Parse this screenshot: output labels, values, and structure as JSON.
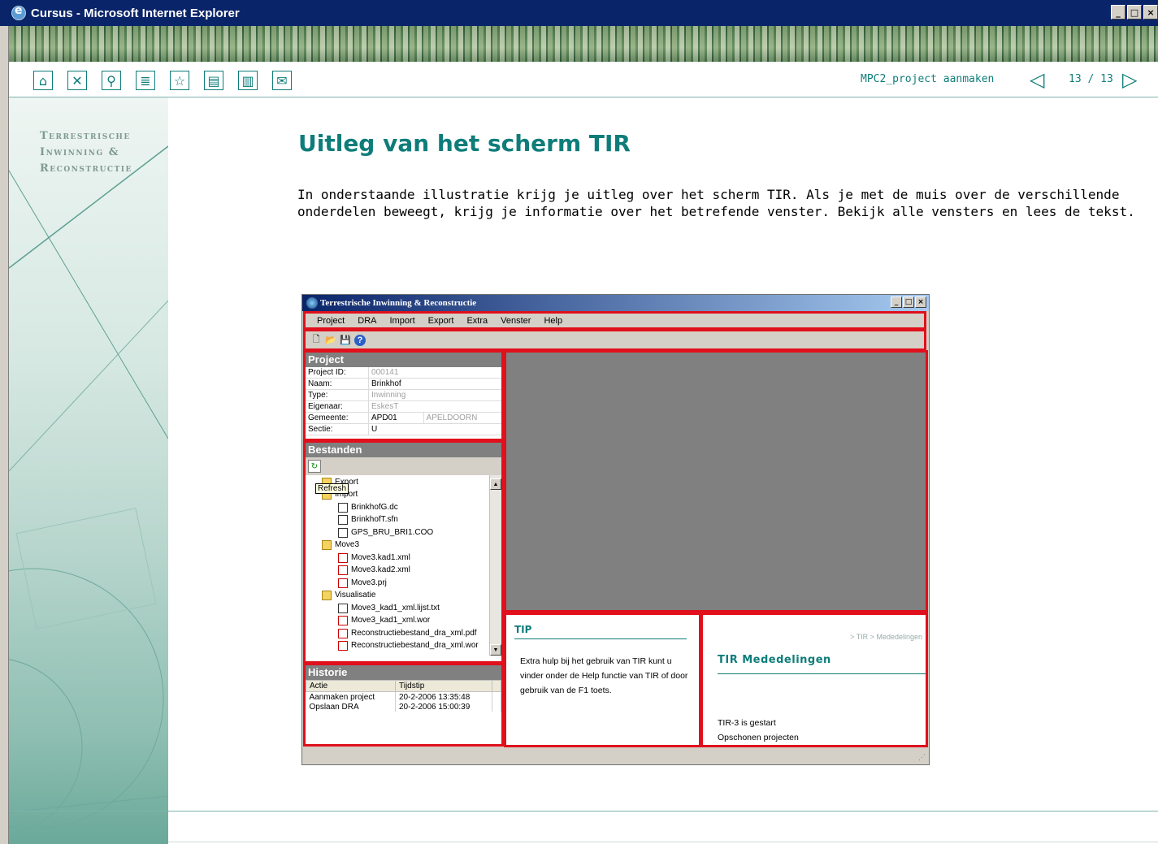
{
  "window": {
    "title": "Cursus - Microsoft Internet Explorer",
    "controls": [
      "_",
      "□",
      "×"
    ]
  },
  "navbar": {
    "icons": [
      "home-icon",
      "close-icon",
      "search-icon",
      "contents-icon",
      "favorite-icon",
      "page-icon",
      "book-icon",
      "mail-icon"
    ],
    "glyphs": [
      "⌂",
      "✕",
      "⚲",
      "≣",
      "☆",
      "▤",
      "▥",
      "✉"
    ],
    "breadcrumb": "MPC2_project aanmaken",
    "prev": "◁",
    "page": "13 / 13",
    "next": "▷"
  },
  "sidebar": {
    "brand_lines": [
      "Terrestrische",
      "Inwinning &",
      "Reconstructie"
    ]
  },
  "main": {
    "title": "Uitleg van het scherm TIR",
    "intro": "In onderstaande illustratie krijg je uitleg over het scherm TIR. Als je met de muis over de verschillende\nonderdelen beweegt, krijg je informatie over het betrefende venster. Bekijk alle vensters en lees de tekst."
  },
  "app": {
    "title": "Terrestrische Inwinning & Reconstructie",
    "controls": [
      "_",
      "□",
      "×"
    ],
    "menu": [
      "Project",
      "DRA",
      "Import",
      "Export",
      "Extra",
      "Venster",
      "Help"
    ],
    "toolbar": [
      "new-icon",
      "open-icon",
      "save-icon",
      "help-icon"
    ],
    "toolbar_glyphs": [
      "🗋",
      "📂",
      "💾",
      "?"
    ],
    "project": {
      "heading": "Project",
      "rows": [
        {
          "label": "Project ID:",
          "value": "000141",
          "extra": ""
        },
        {
          "label": "Naam:",
          "value": "Brinkhof",
          "extra": ""
        },
        {
          "label": "Type:",
          "value": "Inwinning",
          "extra": ""
        },
        {
          "label": "Eigenaar:",
          "value": "EskesT",
          "extra": ""
        },
        {
          "label": "Gemeente:",
          "value": "APD01",
          "extra": "APELDOORN"
        },
        {
          "label": "Sectie:",
          "value": "U",
          "extra": ""
        }
      ]
    },
    "bestanden": {
      "heading": "Bestanden",
      "refresh_icon": "↻",
      "tooltip": "Refresh",
      "items": [
        {
          "text": "Export",
          "kind": "folder",
          "indent": 1
        },
        {
          "text": "Import",
          "kind": "folder",
          "indent": 1
        },
        {
          "text": "BrinkhofG.dc",
          "kind": "file",
          "indent": 2
        },
        {
          "text": "BrinkhofT.sfn",
          "kind": "file",
          "indent": 2
        },
        {
          "text": "GPS_BRU_BRI1.COO",
          "kind": "file",
          "indent": 2
        },
        {
          "text": "Move3",
          "kind": "folder",
          "indent": 1
        },
        {
          "text": "Move3.kad1.xml",
          "kind": "file-red",
          "indent": 2
        },
        {
          "text": "Move3.kad2.xml",
          "kind": "file-red",
          "indent": 2
        },
        {
          "text": "Move3.prj",
          "kind": "file-red",
          "indent": 2
        },
        {
          "text": "Visualisatie",
          "kind": "folder",
          "indent": 1
        },
        {
          "text": "Move3_kad1_xml.lijst.txt",
          "kind": "file",
          "indent": 2
        },
        {
          "text": "Move3_kad1_xml.wor",
          "kind": "file-red",
          "indent": 2
        },
        {
          "text": "Reconstructiebestand_dra_xml.pdf",
          "kind": "file-red",
          "indent": 2
        },
        {
          "text": "Reconstructiebestand_dra_xml.wor",
          "kind": "file-red",
          "indent": 2
        }
      ]
    },
    "historie": {
      "heading": "Historie",
      "columns": [
        "Actie",
        "Tijdstip"
      ],
      "rows": [
        [
          "Aanmaken project",
          "20-2-2006 13:35:48"
        ],
        [
          "Opslaan DRA",
          "20-2-2006 15:00:39"
        ]
      ]
    },
    "tip": {
      "title": "TIP",
      "text": "Extra hulp bij het gebruik van TIR kunt u vinder onder de Help functie van TIR of door gebruik van de F1 toets."
    },
    "mededelingen": {
      "crumb": "> TIR > Mededelingen",
      "title": "TIR Mededelingen",
      "items": [
        "TIR-3 is gestart",
        "Opschonen projecten"
      ]
    },
    "status_grip": "⋰"
  },
  "colors": {
    "accent": "#0e7d7a",
    "highlight": "#e0101c",
    "titlebar": "#0a246a"
  }
}
